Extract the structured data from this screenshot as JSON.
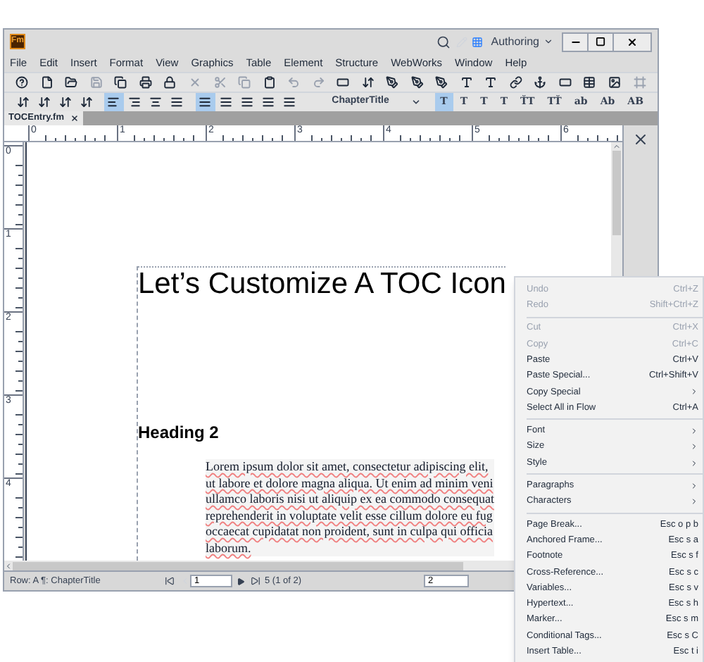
{
  "window": {
    "logo": "Fm",
    "workspace": "Authoring"
  },
  "menu": [
    "File",
    "Edit",
    "Insert",
    "Format",
    "View",
    "Graphics",
    "Table",
    "Element",
    "Structure",
    "WebWorks",
    "Window",
    "Help"
  ],
  "toolbar": [
    {
      "disabled": false
    },
    {
      "disabled": false
    },
    {
      "disabled": false
    },
    {
      "disabled": true
    },
    {
      "disabled": false
    },
    {
      "disabled": false
    },
    {
      "disabled": false
    },
    {
      "disabled": true
    },
    {
      "disabled": true
    },
    {
      "disabled": true
    },
    {
      "disabled": false
    },
    {
      "disabled": true
    },
    {
      "disabled": true
    },
    {
      "disabled": false
    },
    {
      "disabled": false
    },
    {
      "disabled": false
    },
    {
      "disabled": false
    },
    {
      "disabled": false
    },
    {
      "disabled": false
    },
    {
      "disabled": false
    },
    {
      "disabled": false
    },
    {
      "disabled": false
    },
    {
      "disabled": false
    },
    {
      "disabled": false
    },
    {
      "disabled": false
    },
    {
      "disabled": true
    }
  ],
  "format_bar": {
    "align": [
      {
        "selected": true
      },
      {
        "selected": false
      },
      {
        "selected": false
      },
      {
        "selected": false
      }
    ],
    "spacing": [
      {
        "selected": true
      },
      {
        "selected": false
      },
      {
        "selected": false
      },
      {
        "selected": false
      },
      {
        "selected": false
      }
    ],
    "paragraph_tag": "ChapterTitle",
    "char_buttons": [
      {
        "label": "T",
        "selected": true
      },
      {
        "label": "T",
        "selected": false
      },
      {
        "label": "T",
        "selected": false
      },
      {
        "label": "T",
        "selected": false
      },
      {
        "label": "ŤT",
        "selected": false
      },
      {
        "label": "TŤ",
        "selected": false
      },
      {
        "label": "ab",
        "selected": false
      },
      {
        "label": "Ab",
        "selected": false
      },
      {
        "label": "AB",
        "selected": false
      }
    ]
  },
  "tabs": [
    {
      "label": "TOCEntry.fm",
      "selected": true
    }
  ],
  "ruler": {
    "horizontal": [
      "0",
      "1",
      "2",
      "3",
      "4",
      "5",
      "6"
    ],
    "vertical": [
      "0",
      "1",
      "2",
      "3",
      "4"
    ]
  },
  "document": {
    "title": "Let’s Customize A TOC Icon",
    "heading": "Heading 2",
    "body_lines": [
      "Lorem ipsum dolor sit amet, consectetur adipiscing elit,",
      "ut labore et dolore magna aliqua. Ut enim ad minim veni",
      "ullamco laboris nisi ut aliquip ex ea commodo consequat",
      "reprehenderit in voluptate velit esse cillum dolore eu fug",
      "occaecat cupidatat non proident, sunt in culpa qui officia",
      "laborum."
    ]
  },
  "status_bar": {
    "flow": "Row: A ¶: ChapterTitle",
    "page": "1",
    "page_info": "5 (1 of 2)",
    "zoom": "2"
  },
  "context_menu": [
    {
      "kind": "item",
      "label": "Undo",
      "shortcut": "Ctrl+Z",
      "disabled": true,
      "submenu": false
    },
    {
      "kind": "item",
      "label": "Redo",
      "shortcut": "Shift+Ctrl+Z",
      "disabled": true,
      "submenu": false
    },
    {
      "kind": "separator"
    },
    {
      "kind": "item",
      "label": "Cut",
      "shortcut": "Ctrl+X",
      "disabled": true,
      "submenu": false
    },
    {
      "kind": "item",
      "label": "Copy",
      "shortcut": "Ctrl+C",
      "disabled": true,
      "submenu": false
    },
    {
      "kind": "item",
      "label": "Paste",
      "shortcut": "Ctrl+V",
      "disabled": false,
      "submenu": false
    },
    {
      "kind": "item",
      "label": "Paste Special...",
      "shortcut": "Ctrl+Shift+V",
      "disabled": false,
      "submenu": false
    },
    {
      "kind": "item",
      "label": "Copy Special",
      "disabled": false,
      "submenu": true
    },
    {
      "kind": "item",
      "label": "Select All in Flow",
      "shortcut": "Ctrl+A",
      "disabled": false,
      "submenu": false
    },
    {
      "kind": "separator"
    },
    {
      "kind": "item",
      "label": "Font",
      "disabled": false,
      "submenu": true
    },
    {
      "kind": "item",
      "label": "Size",
      "disabled": false,
      "submenu": true
    },
    {
      "kind": "item",
      "label": "Style",
      "disabled": false,
      "submenu": true
    },
    {
      "kind": "separator"
    },
    {
      "kind": "item",
      "label": "Paragraphs",
      "disabled": false,
      "submenu": true
    },
    {
      "kind": "item",
      "label": "Characters",
      "disabled": false,
      "submenu": true
    },
    {
      "kind": "separator"
    },
    {
      "kind": "item",
      "label": "Page Break...",
      "shortcut": "Esc o p b",
      "disabled": false,
      "submenu": false
    },
    {
      "kind": "item",
      "label": "Anchored Frame...",
      "shortcut": "Esc s a",
      "disabled": false,
      "submenu": false
    },
    {
      "kind": "item",
      "label": "Footnote",
      "shortcut": "Esc s f",
      "disabled": false,
      "submenu": false
    },
    {
      "kind": "item",
      "label": "Cross-Reference...",
      "shortcut": "Esc s c",
      "disabled": false,
      "submenu": false
    },
    {
      "kind": "item",
      "label": "Variables...",
      "shortcut": "Esc s v",
      "disabled": false,
      "submenu": false
    },
    {
      "kind": "item",
      "label": "Hypertext...",
      "shortcut": "Esc s h",
      "disabled": false,
      "submenu": false
    },
    {
      "kind": "item",
      "label": "Marker...",
      "shortcut": "Esc s m",
      "disabled": false,
      "submenu": false
    },
    {
      "kind": "item",
      "label": "Conditional Tags...",
      "shortcut": "Esc s C",
      "disabled": false,
      "submenu": false
    },
    {
      "kind": "item",
      "label": "Insert Table...",
      "shortcut": "Esc t i",
      "disabled": false,
      "submenu": false
    }
  ]
}
